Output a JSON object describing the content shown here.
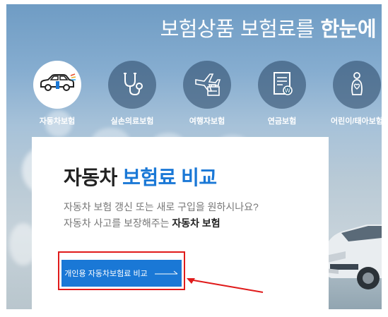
{
  "hero": {
    "title_light": "보험상품 보험료를 ",
    "title_bold": "한눈에"
  },
  "categories": [
    {
      "label": "자동차보험",
      "icon": "car-icon",
      "active": true
    },
    {
      "label": "실손의료보험",
      "icon": "stethoscope-icon",
      "active": false
    },
    {
      "label": "여행자보험",
      "icon": "airplane-luggage-icon",
      "active": false
    },
    {
      "label": "연금보험",
      "icon": "pension-document-icon",
      "active": false
    },
    {
      "label": "어린이/태아보험",
      "icon": "child-icon",
      "active": false
    }
  ],
  "card": {
    "title_normal": "자동차 ",
    "title_accent": "보험료 비교",
    "desc_line1": "자동차 보험 갱신 또는 새로 구입을 원하시나요?",
    "desc_line2_prefix": "자동차 사고를 보장해주는 ",
    "desc_line2_bold": "자동차 보험",
    "cta_label": "개인용 자동차보험료 비교"
  },
  "colors": {
    "accent": "#1a78d6",
    "highlight": "#e01b1b"
  }
}
